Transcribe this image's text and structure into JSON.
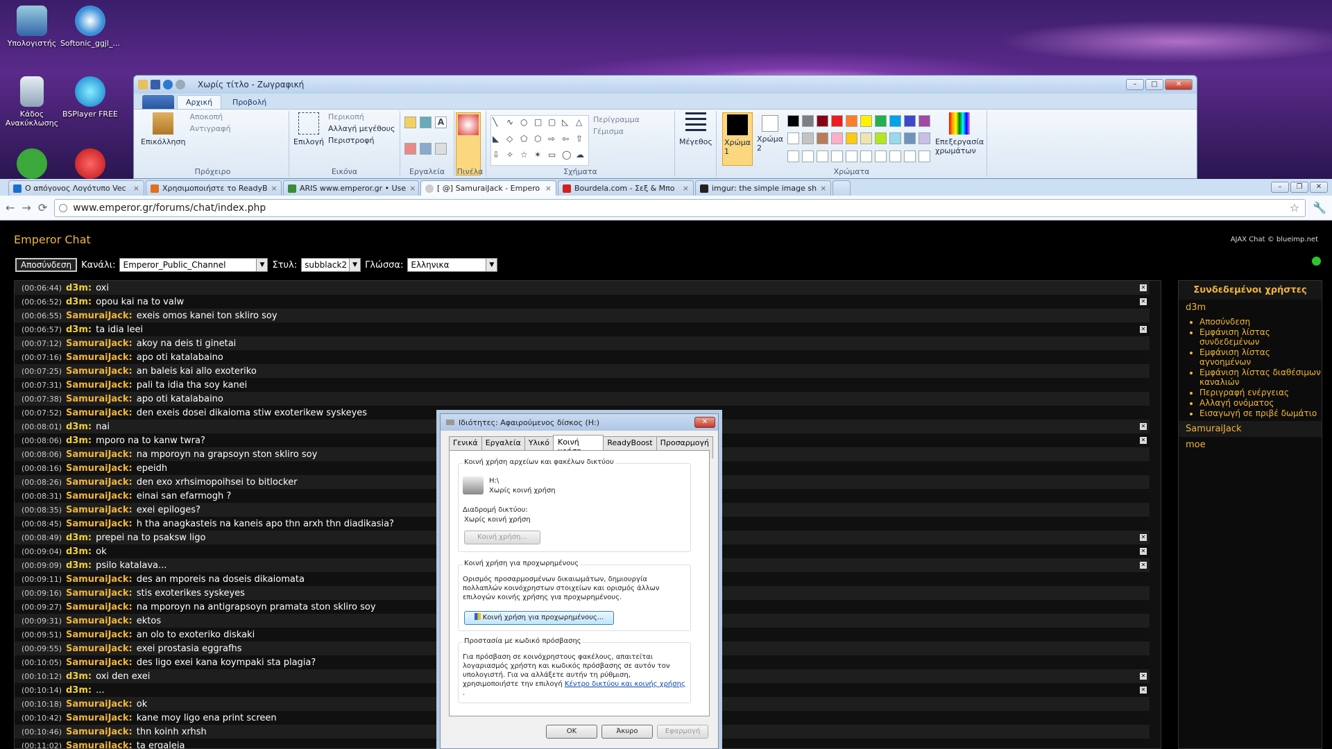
{
  "desktop": {
    "icons": [
      "Υπολογιστής",
      "Softonic_ggjl_...",
      "Κάδος Ανακύκλωσης",
      "BSPlayer FREE"
    ]
  },
  "paint": {
    "title": "Χωρίς τίτλο - Ζωγραφική",
    "tabs": [
      "Αρχική",
      "Προβολή"
    ],
    "groups": {
      "clipboard": {
        "label": "Πρόχειρο",
        "paste": "Επικόλληση",
        "cut": "Αποκοπή",
        "copy": "Αντιγραφή"
      },
      "image": {
        "label": "Εικόνα",
        "select": "Επιλογή",
        "crop": "Περικοπή",
        "resize": "Αλλαγή μεγέθους",
        "rotate": "Περιστροφή"
      },
      "tools": {
        "label": "Εργαλεία"
      },
      "brushes": {
        "label": "Πινέλα"
      },
      "shapes": {
        "label": "Σχήματα",
        "outline": "Περίγραμμα",
        "fill": "Γέμισμα"
      },
      "size": {
        "label": "Μέγεθος"
      },
      "colors": {
        "label": "Χρώματα",
        "color1": "Χρώμα 1",
        "color2": "Χρώμα 2",
        "edit": "Επεξεργασία χρωμάτων"
      }
    },
    "palette": [
      "#000000",
      "#7f7f7f",
      "#880015",
      "#ed1c24",
      "#ff7f27",
      "#fff200",
      "#22b14c",
      "#00a2e8",
      "#3f48cc",
      "#a349a4",
      "#ffffff",
      "#c3c3c3",
      "#b97a57",
      "#ffaec9",
      "#ffc90e",
      "#efe4b0",
      "#b5e61d",
      "#99d9ea",
      "#7092be",
      "#c8bfe7"
    ]
  },
  "browser": {
    "tabs": [
      {
        "label": "Ο απόγονος Λογότυπο Vec",
        "icon": "#1a6fd0"
      },
      {
        "label": "Χρησιμοποιήστε το ReadyB",
        "icon": "#e07020"
      },
      {
        "label": "ARIS www.emperor.gr • Use",
        "icon": "#3a8a3a"
      },
      {
        "label": "[ @] SamuraiJack - Empero",
        "icon": "#cccccc"
      },
      {
        "label": "Bourdela.com - Σεξ & Μπο",
        "icon": "#d02020"
      },
      {
        "label": "imgur: the simple image sh",
        "icon": "#222222"
      }
    ],
    "url": "www.emperor.gr/forums/chat/index.php"
  },
  "chat": {
    "title": "Emperor Chat",
    "credit": "AJAX Chat © blueimp.net",
    "logout": "Αποσύνδεση",
    "channel_label": "Κανάλι:",
    "channel": "Emperor_Public_Channel",
    "style_label": "Στυλ:",
    "style": "subblack2",
    "lang_label": "Γλώσσα:",
    "lang": "Ελληνικα",
    "messages": [
      {
        "t": "(00:06:44)",
        "u": "d3m:",
        "m": "oxi"
      },
      {
        "t": "(00:06:52)",
        "u": "d3m:",
        "m": "opou kai na to valw"
      },
      {
        "t": "(00:06:55)",
        "u": "SamuraiJack:",
        "m": "exeis omos kanei ton skliro soy"
      },
      {
        "t": "(00:06:57)",
        "u": "d3m:",
        "m": "ta idia leei"
      },
      {
        "t": "(00:07:12)",
        "u": "SamuraiJack:",
        "m": "akoy na deis ti ginetai"
      },
      {
        "t": "(00:07:16)",
        "u": "SamuraiJack:",
        "m": "apo oti katalabaino"
      },
      {
        "t": "(00:07:25)",
        "u": "SamuraiJack:",
        "m": "an baleis kai allo exoteriko"
      },
      {
        "t": "(00:07:31)",
        "u": "SamuraiJack:",
        "m": "pali ta idia tha soy kanei"
      },
      {
        "t": "(00:07:38)",
        "u": "SamuraiJack:",
        "m": "apo oti katalabaino"
      },
      {
        "t": "(00:07:52)",
        "u": "SamuraiJack:",
        "m": "den exeis dosei dikaioma stiw exoterikew syskeyes"
      },
      {
        "t": "(00:08:01)",
        "u": "d3m:",
        "m": "nai"
      },
      {
        "t": "(00:08:06)",
        "u": "d3m:",
        "m": "mporo na to kanw twra?"
      },
      {
        "t": "(00:08:06)",
        "u": "SamuraiJack:",
        "m": "na mporoyn na grapsoyn ston skliro soy"
      },
      {
        "t": "(00:08:16)",
        "u": "SamuraiJack:",
        "m": "epeidh"
      },
      {
        "t": "(00:08:26)",
        "u": "SamuraiJack:",
        "m": "den exo xrhsimopoihsei to bitlocker"
      },
      {
        "t": "(00:08:31)",
        "u": "SamuraiJack:",
        "m": "einai san efarmogh ?"
      },
      {
        "t": "(00:08:35)",
        "u": "SamuraiJack:",
        "m": "exei epiloges?"
      },
      {
        "t": "(00:08:45)",
        "u": "SamuraiJack:",
        "m": "h tha anagkasteis na kaneis apo thn arxh thn diadikasia?"
      },
      {
        "t": "(00:08:49)",
        "u": "d3m:",
        "m": "prepei na to psaksw ligo"
      },
      {
        "t": "(00:09:04)",
        "u": "d3m:",
        "m": "ok"
      },
      {
        "t": "(00:09:09)",
        "u": "d3m:",
        "m": "psilo katalava..."
      },
      {
        "t": "(00:09:11)",
        "u": "SamuraiJack:",
        "m": "des an mporeis na doseis dikaiomata"
      },
      {
        "t": "(00:09:16)",
        "u": "SamuraiJack:",
        "m": "stis exoterikes syskeyes"
      },
      {
        "t": "(00:09:27)",
        "u": "SamuraiJack:",
        "m": "na mporoyn na antigrapsoyn pramata ston skliro soy"
      },
      {
        "t": "(00:09:31)",
        "u": "SamuraiJack:",
        "m": "ektos"
      },
      {
        "t": "(00:09:51)",
        "u": "SamuraiJack:",
        "m": "an olo to exoteriko diskaki"
      },
      {
        "t": "(00:09:55)",
        "u": "SamuraiJack:",
        "m": "exei prostasia eggrafhs"
      },
      {
        "t": "(00:10:05)",
        "u": "SamuraiJack:",
        "m": "des ligo exei kana koympaki sta plagia?"
      },
      {
        "t": "(00:10:12)",
        "u": "d3m:",
        "m": "oxi den exei"
      },
      {
        "t": "(00:10:14)",
        "u": "d3m:",
        "m": "..."
      },
      {
        "t": "(00:10:18)",
        "u": "SamuraiJack:",
        "m": "ok"
      },
      {
        "t": "(00:10:42)",
        "u": "SamuraiJack:",
        "m": "kane moy ligo ena print screen"
      },
      {
        "t": "(00:10:46)",
        "u": "SamuraiJack:",
        "m": "thn koinh xrhsh"
      },
      {
        "t": "(00:11:02)",
        "u": "SamuraiJack:",
        "m": "ta ergaleia"
      }
    ],
    "online_title": "Συνδεδεμένοι χρήστες",
    "online_users": [
      "d3m",
      "SamuraiJack",
      "moe"
    ],
    "user_menu": [
      "Αποσύνδεση",
      "Εμφάνιση λίστας συνδεδεμένων",
      "Εμφάνιση λίστας αγνοημένων",
      "Εμφάνιση λίστας διαθέσιμων καναλιών",
      "Περιγραφή ενέργειας",
      "Αλλαγή ονόματος",
      "Εισαγωγή σε πριβέ δωμάτιο"
    ]
  },
  "dialog": {
    "title": "Ιδιότητες: Αφαιρούμενος δίσκος (H:)",
    "tabs": [
      "Γενικά",
      "Εργαλεία",
      "Υλικό",
      "Κοινή χρήση",
      "ReadyBoost",
      "Προσαρμογή"
    ],
    "sec1_title": "Κοινή χρήση αρχείων και φακέλων δικτύου",
    "drive": "H:\\",
    "drive_status": "Χωρίς κοινή χρήση",
    "path_label": "Διαδρομή δικτύου:",
    "path_value": "Χωρίς κοινή χρήση",
    "share_btn": "Κοινή χρήση...",
    "sec2_title": "Κοινή χρήση για προχωρημένους",
    "sec2_text": "Ορισμός προσαρμοσμένων δικαιωμάτων, δημιουργία πολλαπλών κοινόχρηστων στοιχείων και ορισμός άλλων επιλογών κοινής χρήσης για προχωρημένους.",
    "adv_btn": "Κοινή χρήση για προχωρημένους...",
    "sec3_title": "Προστασία με κωδικό πρόσβασης",
    "sec3_text": "Για πρόσβαση σε κοινόχρηστους φακέλους, απαιτείται λογαριασμός χρήστη και κωδικός πρόσβασης σε αυτόν τον υπολογιστή. Για να αλλάξετε αυτήν τη ρύθμιση, χρησιμοποιήστε την επιλογή",
    "sec3_link": "Κέντρο δικτύου και κοινής χρήσης",
    "sec3_tail": ".",
    "ok": "OK",
    "cancel": "Άκυρο",
    "apply": "Εφαρμογή"
  }
}
